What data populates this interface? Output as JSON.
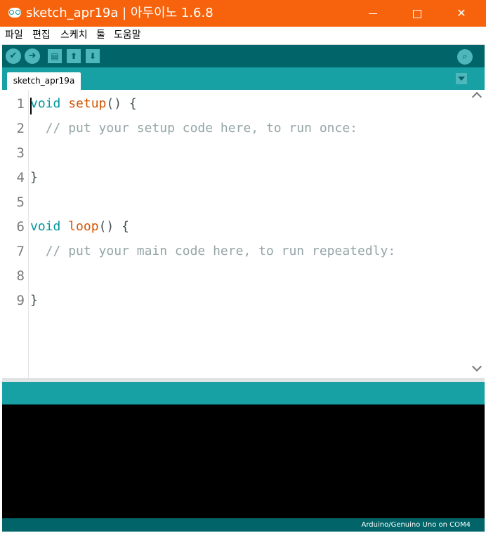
{
  "window": {
    "title": "sketch_apr19a | 아두이노 1.6.8",
    "controls": {
      "minimize": "",
      "maximize": "",
      "close": "✕"
    }
  },
  "menu": {
    "items": [
      "파일",
      "편집",
      "스케치",
      "툴",
      "도움말"
    ]
  },
  "toolbar": {
    "verify_icon": "✔",
    "upload_icon": "➜",
    "new_icon": "▤",
    "open_icon": "⬆",
    "save_icon": "⬇",
    "serial_icon": "⌕",
    "icons": [
      "check-icon",
      "arrow-right-icon",
      "new-file-icon",
      "open-arrow-up-icon",
      "save-arrow-down-icon",
      "magnifier-icon"
    ]
  },
  "tabs": {
    "active": "sketch_apr19a"
  },
  "editor": {
    "lines": [
      {
        "n": "1",
        "text": "void setup() {"
      },
      {
        "n": "2",
        "text": "  // put your setup code here, to run once:"
      },
      {
        "n": "3",
        "text": ""
      },
      {
        "n": "4",
        "text": "}"
      },
      {
        "n": "5",
        "text": ""
      },
      {
        "n": "6",
        "text": "void loop() {"
      },
      {
        "n": "7",
        "text": "  // put your main code here, to run repeatedly:"
      },
      {
        "n": "8",
        "text": ""
      },
      {
        "n": "9",
        "text": "}"
      }
    ],
    "colors": {
      "keyword": "#00979c",
      "function": "#d35400",
      "comment": "#95a5a6",
      "text": "#434f54"
    }
  },
  "footer": {
    "board_status": "Arduino/Genuino Uno on COM4"
  },
  "theme": {
    "titlebar": "#f7630c",
    "toolbar": "#006468",
    "tabbar": "#17a1a5",
    "console": "#000000"
  }
}
